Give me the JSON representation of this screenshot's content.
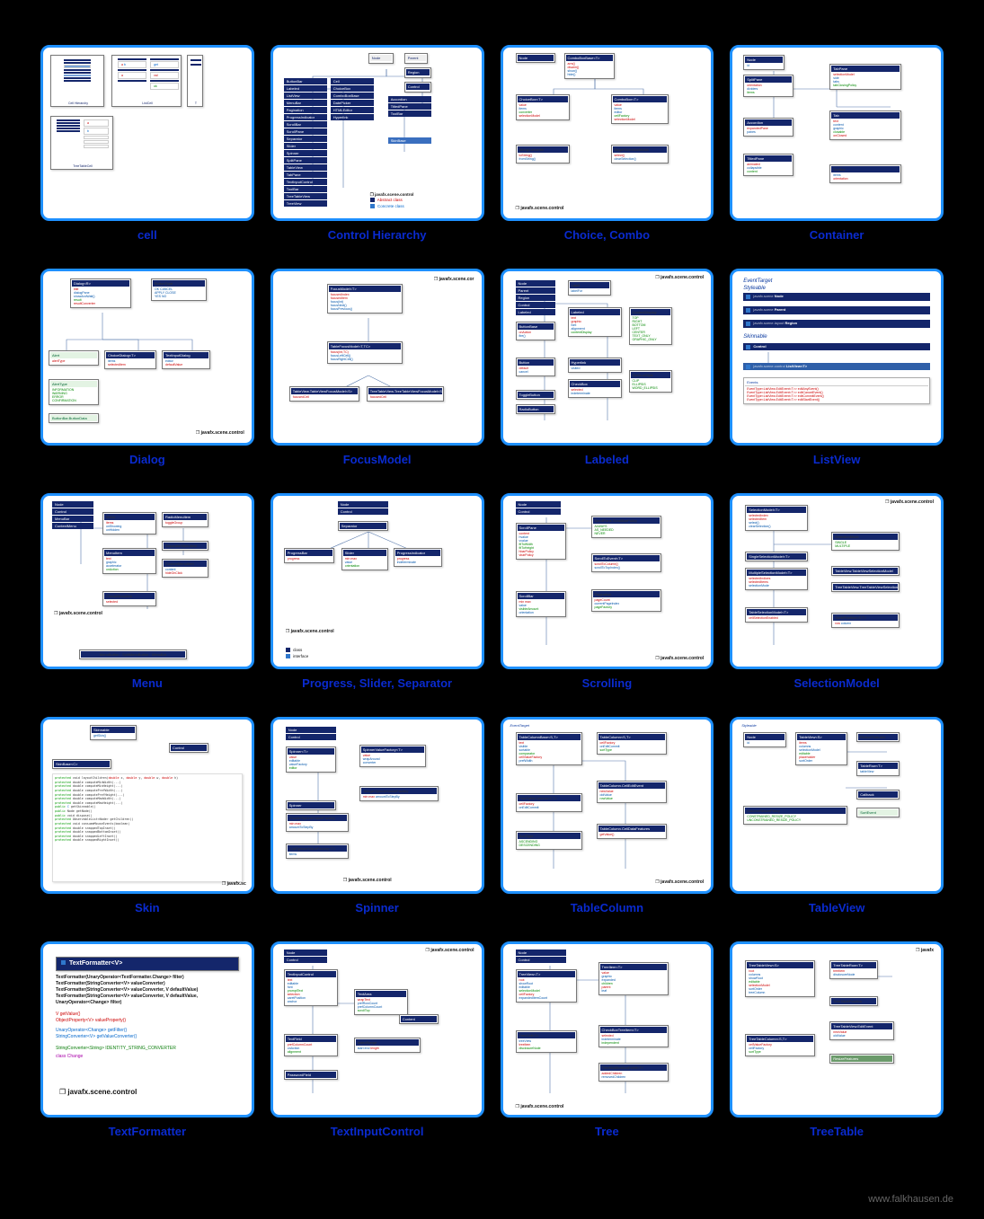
{
  "footer": "www.falkhausen.de",
  "thumbs": [
    {
      "label": "cell"
    },
    {
      "label": "Control Hierarchy"
    },
    {
      "label": "Choice, Combo"
    },
    {
      "label": "Container"
    },
    {
      "label": "Dialog"
    },
    {
      "label": "FocusModel"
    },
    {
      "label": "Labeled"
    },
    {
      "label": "ListView"
    },
    {
      "label": "Menu"
    },
    {
      "label": "Progress, Slider, Separator"
    },
    {
      "label": "Scrolling"
    },
    {
      "label": "SelectionModel"
    },
    {
      "label": "Skin"
    },
    {
      "label": "Spinner"
    },
    {
      "label": "TableColumn"
    },
    {
      "label": "TableView"
    },
    {
      "label": "TextFormatter"
    },
    {
      "label": "TextInputControl"
    },
    {
      "label": "Tree"
    },
    {
      "label": "TreeTable"
    }
  ],
  "pkg": "javafx.scene.control",
  "pkg_short": "javafx.scene.cor",
  "textformatter": {
    "title": "TextFormatter<V>",
    "lines_dark": [
      "TextFormatter(UnaryOperator<TextFormatter.Change> filter)",
      "TextFormatter(StringConverter<V> valueConverter)",
      "TextFormatter(StringConverter<V> valueConverter, V defaultValue)",
      "TextFormatter(StringConverter<V> valueConverter, V defaultValue, UnaryOperator<Change> filter)"
    ],
    "lines_red": [
      "V getValue()",
      "ObjectProperty<V> valueProperty()"
    ],
    "lines_blue": [
      "UnaryOperator<Change> getFilter()",
      "StringConverter<V> getValueConverter()"
    ],
    "green": "StringConverter<String> IDENTITY_STRING_CONVERTER",
    "magenta": "class Change"
  },
  "listview": {
    "italic": [
      "EventTarget",
      "Styleable"
    ],
    "chain": [
      {
        "pkg": "javafx.scene",
        "cls": "Node"
      },
      {
        "pkg": "javafx.scene",
        "cls": "Parent"
      },
      {
        "pkg": "javafx.scene.layout",
        "cls": "Region"
      }
    ],
    "skinnable": "Skinnable",
    "control": "Control",
    "target_pkg": "javafx.scene.control",
    "target_cls": "ListView<T>",
    "ev_label": "Events",
    "ev_lines": [
      "EventType<ListView.EditEvent<T>> editAnyEvent()",
      "EventType<ListView.EditEvent<T>> editCancelEvent()",
      "EventType<ListView.EditEvent<T>> editCommitEvent()",
      "EventType<ListView.EditEvent<T>> editStartEvent()"
    ]
  },
  "skin": {
    "c1": "Skinnable",
    "c2": "Control",
    "small_methods": 18
  }
}
